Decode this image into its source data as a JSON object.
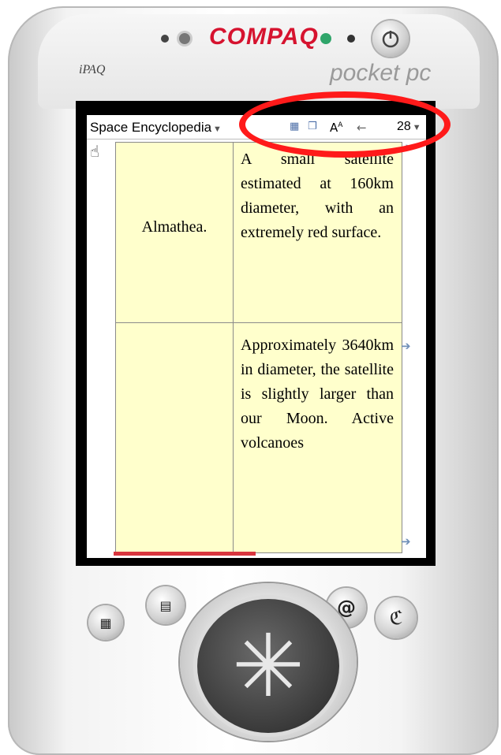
{
  "device": {
    "brand": "COMPAQ",
    "model_logo": "iPAQ",
    "platform": "pocket pc",
    "colors": {
      "brand_red": "#d6132f",
      "led_green": "#2fa56a",
      "annotation_red": "#ff1a1a",
      "cell_yellow": "#ffffcc",
      "progress_red": "#d9363e"
    }
  },
  "app": {
    "title": "Space Encyclopedia",
    "toolbar_icons": [
      "book-icon",
      "copy-pages-icon",
      "font-size-icon",
      "back-arrow-icon"
    ],
    "font_size_label": "A",
    "page_number": "28"
  },
  "table": {
    "rows": [
      {
        "name": "Almathea.",
        "description": "A small satellite estimated at 160km diameter, with an extremely red surface."
      },
      {
        "name": "",
        "description": "Approximately 3640km in diameter, the satellite is slightly larger than our Moon. Active volcanoes"
      }
    ]
  },
  "icons": {
    "hand_cursor": "hand-pointer-icon",
    "row_arrow": "right-arrow-icon",
    "dpad": "dpad-icon",
    "power": "power-icon",
    "calendar": "calendar-icon",
    "contacts": "contacts-icon",
    "inbox": "inbox-icon",
    "media": "media-icon"
  },
  "scroll_progress_fraction": 0.42
}
